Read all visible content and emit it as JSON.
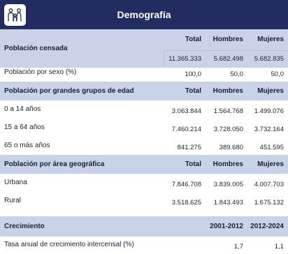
{
  "title": "Demografía",
  "logo_icon": "family-icon",
  "censo": {
    "label": "Población censada",
    "cols": [
      "Total",
      "Hombres",
      "Mujeres"
    ],
    "values": [
      "11.365.333",
      "5.682.498",
      "5.682.835"
    ]
  },
  "sexo": {
    "label": "Población por sexo (%)",
    "values": [
      "100,0",
      "50,0",
      "50,0"
    ]
  },
  "edad": {
    "label": "Población por grandes grupos de edad",
    "cols": [
      "Total",
      "Hombres",
      "Mujeres"
    ],
    "rows": [
      {
        "label": "0 a 14 años",
        "values": [
          "3.063.844",
          "1.564.768",
          "1.499.076"
        ]
      },
      {
        "label": "15 a 64 años",
        "values": [
          "7.460.214",
          "3.728.050",
          "3.732.164"
        ]
      },
      {
        "label": "65 o más años",
        "values": [
          "841.275",
          "389.680",
          "451.595"
        ]
      }
    ]
  },
  "area": {
    "label": "Población por área geográfica",
    "cols": [
      "Total",
      "Hombres",
      "Mujeres"
    ],
    "rows": [
      {
        "label": "Urbana",
        "values": [
          "7.846.708",
          "3.839.005",
          "4.007.703"
        ]
      },
      {
        "label": "Rural",
        "values": [
          "3.518.625",
          "1.843.493",
          "1.675.132"
        ]
      }
    ]
  },
  "crecimiento": {
    "label": "Crecimiento",
    "cols": [
      "2001-2012",
      "2012-2024"
    ],
    "row": {
      "label": "Tasa anual de crecimiento intercensal (%)",
      "values": [
        "1,7",
        "1,1"
      ]
    }
  },
  "colors": {
    "header": "#232c61",
    "band": "#c8d2e9",
    "line": "#b8c3dd"
  }
}
